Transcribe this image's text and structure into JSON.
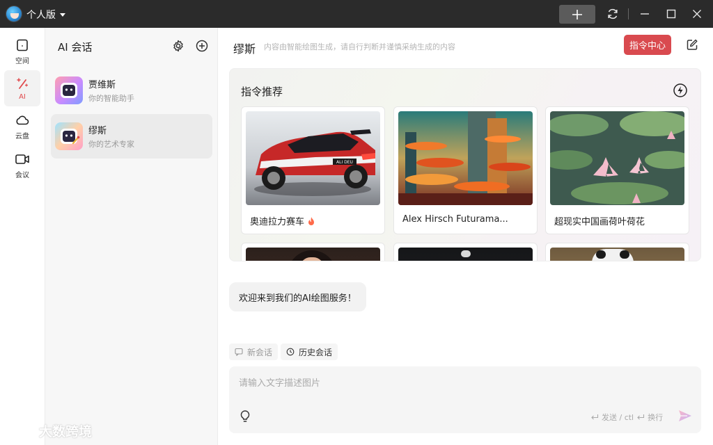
{
  "titlebar": {
    "edition_label": "个人版",
    "new_label": "+"
  },
  "rail": {
    "items": [
      {
        "label": "空间",
        "icon": "space-icon",
        "active": false
      },
      {
        "label": "AI",
        "icon": "ai-wand-icon",
        "active": true
      },
      {
        "label": "云盘",
        "icon": "cloud-icon",
        "active": false
      },
      {
        "label": "会议",
        "icon": "video-camera-icon",
        "active": false
      }
    ]
  },
  "convlist": {
    "title": "AI 会话",
    "items": [
      {
        "name": "贾维斯",
        "desc": "你的智能助手",
        "active": false
      },
      {
        "name": "缪斯",
        "desc": "你的艺术专家",
        "active": true
      }
    ]
  },
  "main": {
    "assistant_name": "缪斯",
    "disclaimer": "内容由智能绘图生成，请自行判断并谨慎采纳生成的内容",
    "command_center_label": "指令中心",
    "reco_title": "指令推荐",
    "cards": [
      {
        "title": "奥迪拉力赛车",
        "hot": true
      },
      {
        "title": "Alex Hirsch Futurama...",
        "hot": false
      },
      {
        "title": "超现实中国画荷叶荷花",
        "hot": false
      }
    ],
    "welcome_message": "欢迎来到我们的AI绘图服务！",
    "new_chat_label": "新会话",
    "history_label": "历史会话",
    "input_placeholder": "请输入文字描述图片",
    "send_hint": "发送 / ctl",
    "newline_hint": "换行"
  },
  "watermark": "大数跨境",
  "colors": {
    "accent": "#d94a4f",
    "titlebar": "#2b2b2b"
  }
}
